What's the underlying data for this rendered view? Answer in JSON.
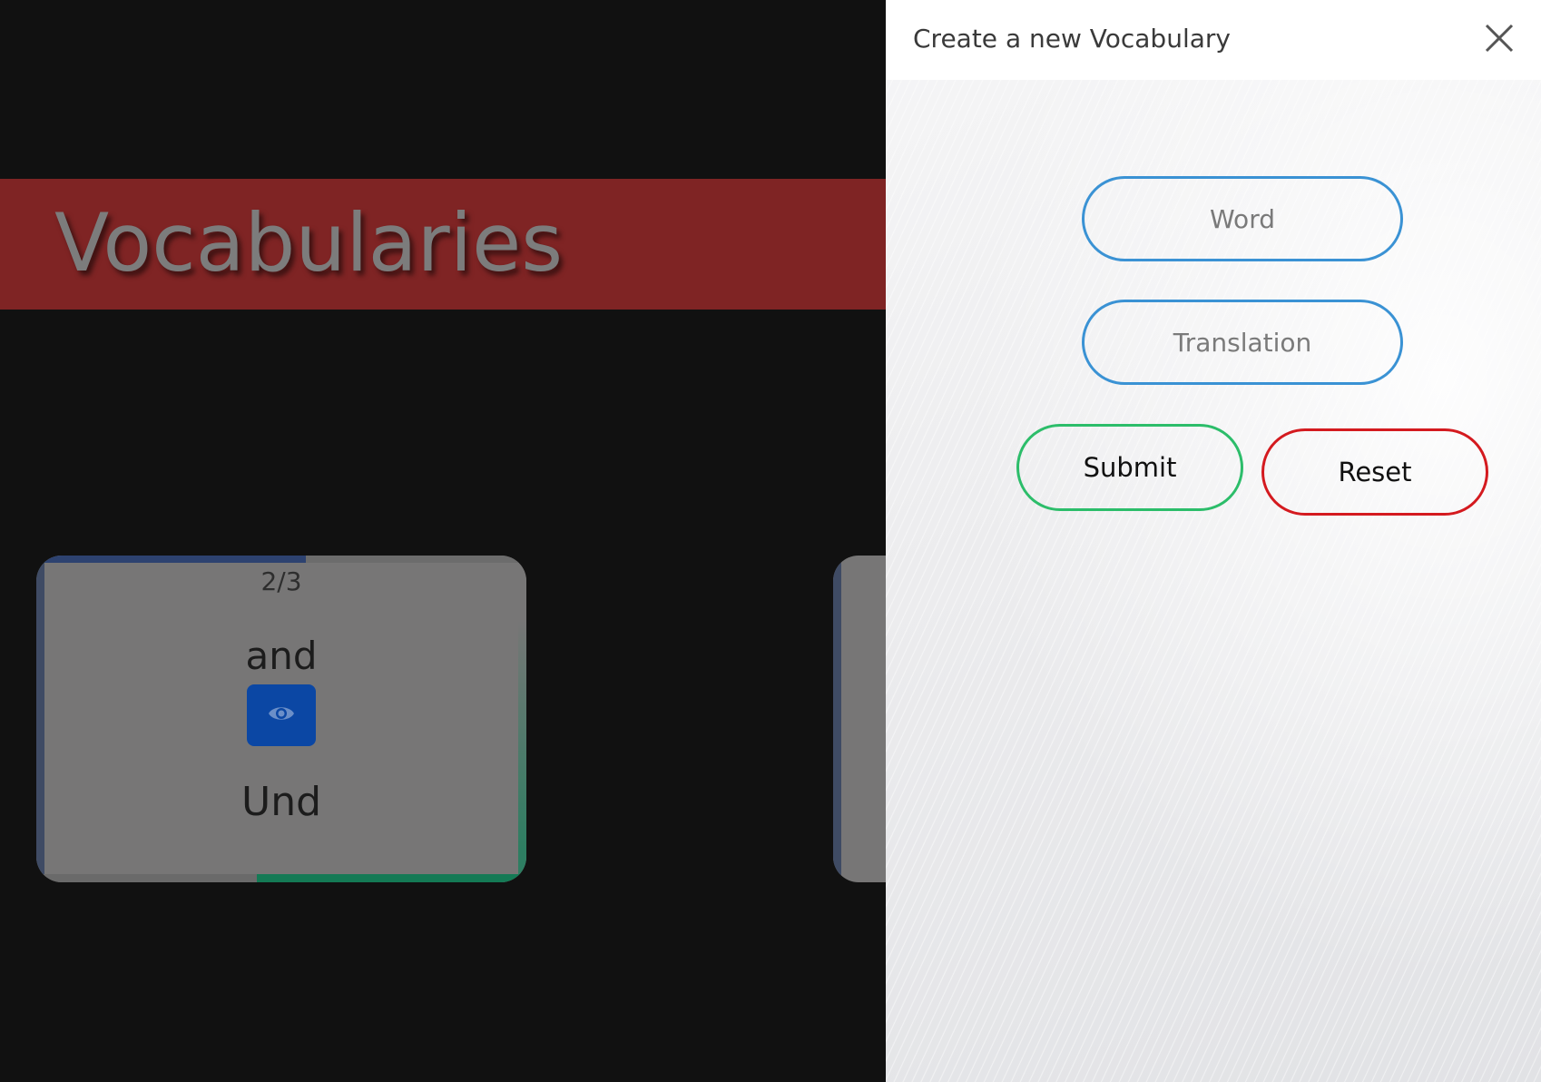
{
  "page": {
    "title": "Vocabularies"
  },
  "card": {
    "counter": "2/3",
    "word": "and",
    "translation": "Und",
    "reveal_icon": "eye-icon",
    "progress_top_fraction": 0.55,
    "progress_bottom_fraction": 0.55
  },
  "panel": {
    "title": "Create a new Vocabulary",
    "close_icon": "close-icon",
    "word_placeholder": "Word",
    "translation_placeholder": "Translation",
    "submit_label": "Submit",
    "reset_label": "Reset"
  },
  "colors": {
    "banner": "#7f2424",
    "input_border": "#3a92d4",
    "submit_border": "#2cbd6a",
    "reset_border": "#d41a1f",
    "reveal_button": "#0b47a4"
  }
}
